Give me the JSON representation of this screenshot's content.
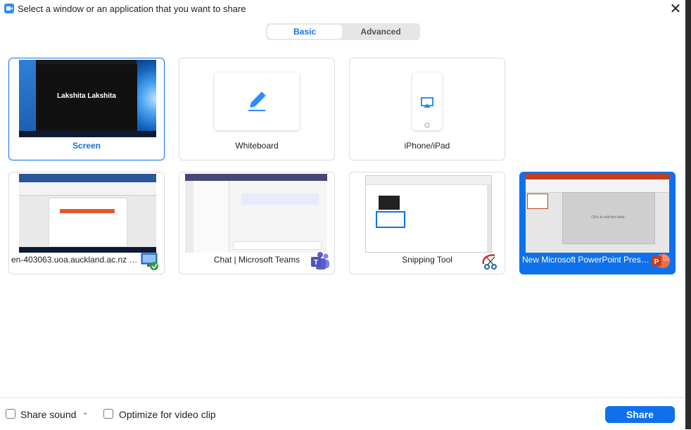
{
  "window": {
    "title": "Select a window or an application that you want to share"
  },
  "tabs": [
    {
      "label": "Basic",
      "active": true
    },
    {
      "label": "Advanced",
      "active": false
    }
  ],
  "tiles": [
    {
      "label": "Screen",
      "selected": true,
      "thumb_text": "Lakshita Lakshita"
    },
    {
      "label": "Whiteboard"
    },
    {
      "label": "iPhone/iPad"
    },
    {
      "label": "en-403063.uoa.auckland.ac.nz - R..."
    },
    {
      "label": "Chat | Microsoft Teams"
    },
    {
      "label": "Snipping Tool"
    },
    {
      "label": "New Microsoft PowerPoint Prese...",
      "highlighted": true,
      "slide_placeholder": "Click to add first slide"
    }
  ],
  "footer": {
    "share_sound": "Share sound",
    "optimize": "Optimize for video clip",
    "share_button": "Share"
  },
  "colors": {
    "accent": "#0e71eb",
    "teams": "#5b5fc7",
    "powerpoint": "#c43e1c"
  },
  "icons": [
    "zoom-app-icon",
    "close-icon",
    "whiteboard-pen-icon",
    "airplay-icon",
    "remote-desktop-icon",
    "teams-icon",
    "snipping-tool-icon",
    "powerpoint-icon",
    "chevron-down-icon"
  ]
}
